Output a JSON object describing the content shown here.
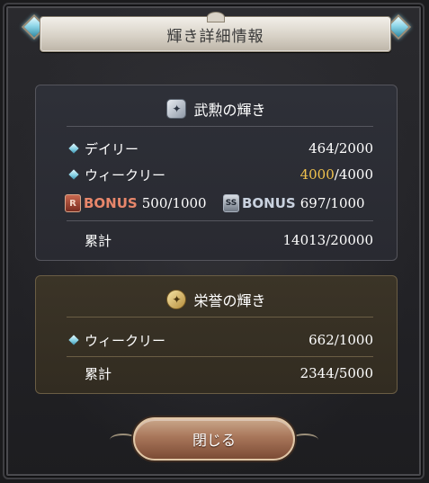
{
  "title": "輝き詳細情報",
  "buk": {
    "header": "武勲の輝き",
    "icon": "star-shield-icon",
    "daily": {
      "label": "デイリー",
      "value": "464/2000"
    },
    "weekly": {
      "label": "ウィークリー",
      "value_highlight": "4000",
      "value_rest": "/4000"
    },
    "bonus1": {
      "label": "BONUS",
      "value": "500/1000",
      "icon": "red-bonus-badge-icon",
      "badge": "R"
    },
    "bonus2": {
      "label": "BONUS",
      "value": "697/1000",
      "icon": "silver-bonus-badge-icon",
      "badge": "SS"
    },
    "total": {
      "label": "累計",
      "value": "14013/20000"
    }
  },
  "eiyo": {
    "header": "栄誉の輝き",
    "icon": "gold-star-icon",
    "weekly": {
      "label": "ウィークリー",
      "value": "662/1000"
    },
    "total": {
      "label": "累計",
      "value": "2344/5000"
    }
  },
  "close_label": "閉じる",
  "colors": {
    "highlight": "#f1c24d",
    "bonus_red": "#e8876b",
    "bonus_silver": "#c9d2df",
    "button": "#a8765a"
  }
}
